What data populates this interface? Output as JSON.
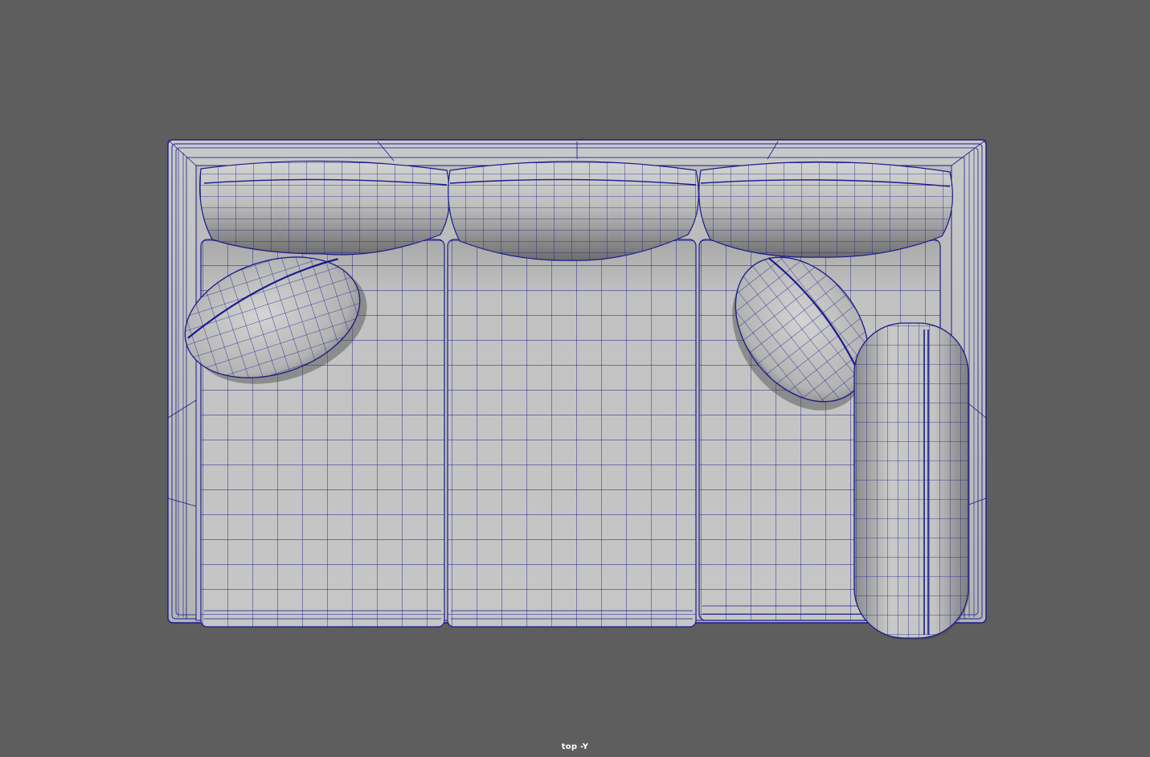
{
  "viewport": {
    "camera_label": "top -Y",
    "background_color": "#5e5e5e",
    "wireframe_color": "#1a1a8c",
    "shaded_color": "#bdbdbd"
  },
  "scene": {
    "object": "sofa",
    "parts": [
      "sofa-frame",
      "back-cushion-left",
      "back-cushion-middle",
      "back-cushion-right",
      "seat-cushion-left",
      "seat-cushion-middle",
      "seat-cushion-right",
      "throw-pillow-left",
      "throw-pillow-right",
      "bolster-pillow"
    ]
  }
}
